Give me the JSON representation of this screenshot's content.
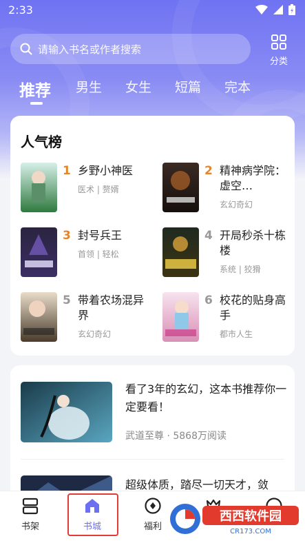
{
  "status": {
    "time": "2:33"
  },
  "search": {
    "placeholder": "请输入书名或作者搜索"
  },
  "category_button": {
    "label": "分类"
  },
  "tabs": [
    {
      "label": "推荐",
      "active": true
    },
    {
      "label": "男生"
    },
    {
      "label": "女生"
    },
    {
      "label": "短篇"
    },
    {
      "label": "完本"
    }
  ],
  "ranking": {
    "title": "人气榜",
    "items": [
      {
        "rank": "1",
        "name": "乡野小神医",
        "tags": "医术 | 赘婿",
        "rank_color": "#e6862a",
        "cover_text": "乡野小神医"
      },
      {
        "rank": "2",
        "name": "精神病学院：虚空…",
        "tags": "玄幻奇幻",
        "rank_color": "#e6862a",
        "cover_text": "精神病学院"
      },
      {
        "rank": "3",
        "name": "封号兵王",
        "tags": "首领 | 轻松",
        "rank_color": "#e6862a",
        "cover_text": "封号兵王"
      },
      {
        "rank": "4",
        "name": "开局秒杀十栋楼",
        "tags": "系统 | 狡猾",
        "rank_color": "#999999",
        "cover_text": "开局秒杀十栋楼"
      },
      {
        "rank": "5",
        "name": "带着农场混异界",
        "tags": "玄幻奇幻",
        "rank_color": "#999999",
        "cover_text": "带着农场混异界"
      },
      {
        "rank": "6",
        "name": "校花的贴身高手",
        "tags": "都市人生",
        "rank_color": "#999999",
        "cover_text": "校花的贴身高手"
      }
    ]
  },
  "feature": {
    "title": "看了3年的玄幻，这本书推荐你一定要看！",
    "book": "武道至尊",
    "reads": "5868万阅读",
    "next_title": "超级体质，踏尽一切天才，敛"
  },
  "nav": [
    {
      "label": "书架",
      "icon": "bookshelf-icon"
    },
    {
      "label": "书城",
      "icon": "store-icon",
      "active": true
    },
    {
      "label": "福利",
      "icon": "gift-icon"
    },
    {
      "label": "",
      "icon": "crown-icon"
    },
    {
      "label": "",
      "icon": "profile-icon"
    }
  ],
  "watermark": {
    "text": "西西软件园",
    "sub": "CR173.COM"
  },
  "colors": {
    "accent": "#6c6ff0",
    "highlight": "#e53935",
    "rank_top": "#e6862a"
  }
}
